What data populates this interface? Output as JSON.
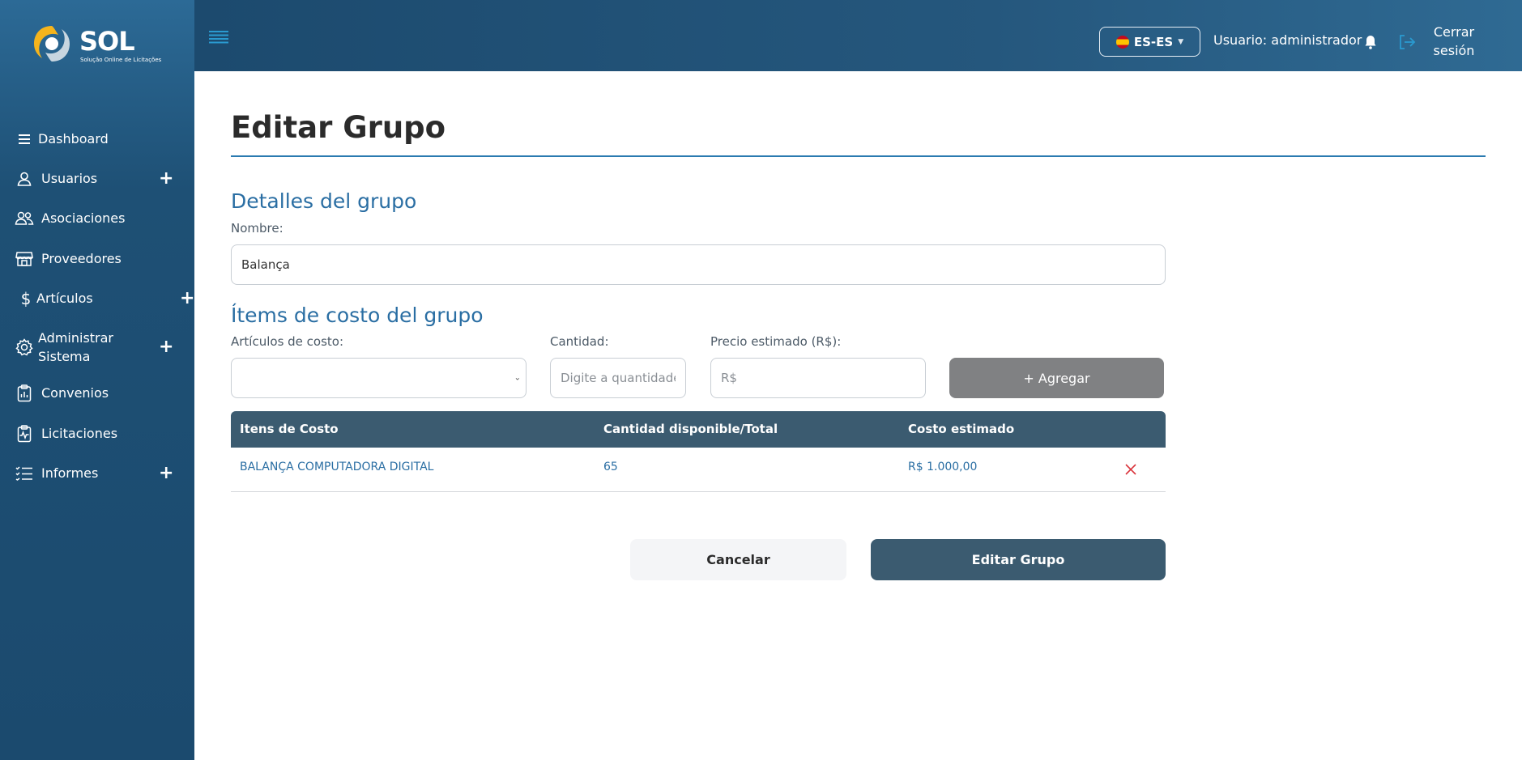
{
  "brand": {
    "name": "SOL",
    "tagline": "Solução Online de Licitações"
  },
  "sidebar": {
    "items": [
      {
        "label": "Dashboard",
        "icon": "menu-icon",
        "expandable": false
      },
      {
        "label": "Usuarios",
        "icon": "user-icon",
        "expandable": true
      },
      {
        "label": "Asociaciones",
        "icon": "users-icon",
        "expandable": false
      },
      {
        "label": "Proveedores",
        "icon": "store-icon",
        "expandable": false
      },
      {
        "label": "Artículos",
        "icon": "dollar-icon",
        "expandable": true
      },
      {
        "label": "Administrar Sistema",
        "icon": "gear-icon",
        "expandable": true
      },
      {
        "label": "Convenios",
        "icon": "clipboard-chart-icon",
        "expandable": false
      },
      {
        "label": "Licitaciones",
        "icon": "clipboard-pulse-icon",
        "expandable": false
      },
      {
        "label": "Informes",
        "icon": "list-check-icon",
        "expandable": true
      }
    ],
    "plus_symbol": "+"
  },
  "header": {
    "language": "ES-ES",
    "user": "Usuario: administrador",
    "logout": "Cerrar sesión"
  },
  "page": {
    "title": "Editar Grupo"
  },
  "details": {
    "section_title": "Detalles del grupo",
    "name_label": "Nombre:",
    "name_value": "Balança"
  },
  "cost_items": {
    "section_title": "Ítems de costo del grupo",
    "article_label": "Artículos de costo:",
    "article_value": "",
    "quantity_label": "Cantidad:",
    "quantity_placeholder": "Digite a quantidade",
    "price_label": "Precio estimado (R$):",
    "price_placeholder": "R$",
    "add_button": "+ Agregar"
  },
  "table": {
    "headers": [
      "Itens de Costo",
      "Cantidad disponible/Total",
      "Costo estimado"
    ],
    "rows": [
      {
        "item": "BALANÇA COMPUTADORA DIGITAL",
        "quantity": "65",
        "cost": "R$ 1.000,00"
      }
    ]
  },
  "actions": {
    "cancel": "Cancelar",
    "submit": "Editar Grupo"
  },
  "colors": {
    "sidebar": "#1b4a6e",
    "primary_dark": "#3b5b70",
    "accent_blue": "#2a6ea3",
    "delete_red": "#d9323a",
    "add_button_gray": "#808183"
  }
}
